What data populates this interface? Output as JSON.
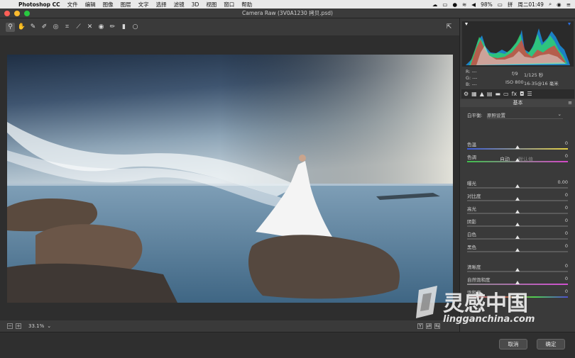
{
  "menubar": {
    "app": "Photoshop CC",
    "items": [
      "文件",
      "编辑",
      "图像",
      "图层",
      "文字",
      "选择",
      "滤镜",
      "3D",
      "视图",
      "窗口",
      "帮助"
    ],
    "battery": "98%",
    "clock": "周二01:49"
  },
  "window": {
    "title": "Camera Raw (3V0A1230 拷贝.psd)"
  },
  "status": {
    "zoom": "33.1%"
  },
  "camera_info": {
    "r": "R:  ---",
    "g": "G:  ---",
    "b": "B:  ---",
    "aperture": "f/9",
    "shutter": "1/125 秒",
    "iso": "ISO 800",
    "lens": "16-35@16 毫米"
  },
  "panel": {
    "section": "基本",
    "wb_label": "白平衡:",
    "wb_value": "原照设置",
    "auto": "自动",
    "default": "默认值",
    "sliders": [
      {
        "label": "色温",
        "value": "0",
        "pos": 0.5
      },
      {
        "label": "色调",
        "value": "0",
        "pos": 0.5
      },
      {
        "label": "曝光",
        "value": "0.00",
        "pos": 0.5
      },
      {
        "label": "对比度",
        "value": "0",
        "pos": 0.5
      },
      {
        "label": "高光",
        "value": "0",
        "pos": 0.5
      },
      {
        "label": "阴影",
        "value": "0",
        "pos": 0.5
      },
      {
        "label": "白色",
        "value": "0",
        "pos": 0.5
      },
      {
        "label": "黑色",
        "value": "0",
        "pos": 0.5
      },
      {
        "label": "清晰度",
        "value": "0",
        "pos": 0.5
      },
      {
        "label": "自然饱和度",
        "value": "0",
        "pos": 0.5
      },
      {
        "label": "饱和度",
        "value": "0",
        "pos": 0.5
      }
    ]
  },
  "buttons": {
    "cancel": "取消",
    "ok": "确定"
  },
  "watermark": {
    "brand": "灵感中国",
    "url": "lingganchina.com"
  }
}
